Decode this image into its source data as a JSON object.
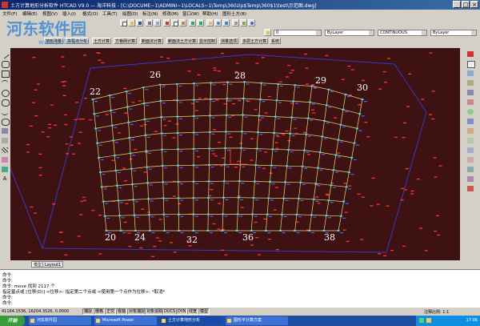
{
  "window": {
    "title": "土方计算地形分析软件 HTCAD V9.0 — 海洋科技 - [C:\\DOCUME~1\\ADMINI~1\\LOCALS~1\\Temp\\360zip$Temp\\360$1\\test\\示范图.dwg]",
    "min_label": "_",
    "max_label": "□",
    "close_label": "×"
  },
  "watermark": {
    "text": "河东软件园",
    "url": "www.pc0359.cn"
  },
  "menubar": {
    "items": [
      "文件(F)",
      "编辑(E)",
      "视图(V)",
      "插入(I)",
      "格式(O)",
      "工具(T)",
      "绘图(D)",
      "标注(N)",
      "修改(M)",
      "窗口(W)",
      "帮助(H)",
      "图形土方(B)"
    ]
  },
  "toolbar": {
    "layer_combo": "0",
    "color_combo": "ByLayer",
    "linetype_combo": "CONTINUOUS",
    "lineweight_combo": "ByLayer"
  },
  "command_buttons": [
    "地形测量",
    "高程点分析",
    "土方计算",
    "方格网计算",
    "断面法计算",
    "断面法土方计算",
    "显示控制",
    "测量选项",
    "多层土方计算",
    "系统"
  ],
  "drawing": {
    "corner_labels": [
      "22",
      "26",
      "28",
      "29",
      "30",
      "20",
      "24",
      "32",
      "36",
      "38"
    ]
  },
  "layout_tabs": [
    "模型",
    "Layout1"
  ],
  "command_window": {
    "lines": [
      "命令:",
      "命令:",
      "命令:  move 找到 2117 个",
      "指定基点或 [位移(D)] <位移>:  指定第二个点或 <使用第一个点作为位移>: *取消*",
      "命令:",
      "命令:"
    ]
  },
  "statusbar": {
    "coords": "41164.1536, 16204.3526, 0.0000",
    "buttons": [
      "捕捉",
      "栅格",
      "正交",
      "极轴",
      "对象捕捉",
      "对象追踪",
      "DUCS",
      "DYN",
      "线宽",
      "模型"
    ],
    "right_text": "注释比例: 1:1"
  },
  "taskbar": {
    "start": "开始",
    "tasks": [
      "河东软件园",
      "Microsoft Power",
      "土方计算地形分析",
      "图形平计算方案"
    ],
    "clock": "17:06"
  },
  "colors": {
    "title_start": "#0a246a",
    "canvas_bg": "#3e1212",
    "grid_line": "#e8e070",
    "label_text": "#ffffff",
    "grid_point": "#40d8e8",
    "elevation_text": "#ff3333",
    "boundary_line": "#3838c8",
    "taskbar": "#1f4fa3"
  }
}
